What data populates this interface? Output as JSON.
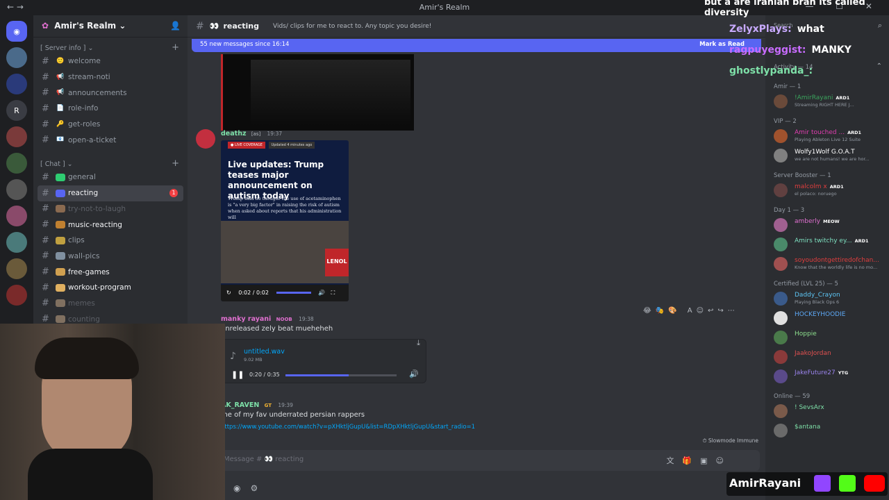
{
  "window": {
    "title": "Amir's Realm",
    "top_overlay_text": "but a are iranian bran its called diversity"
  },
  "server": {
    "name": "Amir's Realm",
    "rail_letter": "R"
  },
  "categories": {
    "server_info": "[ Server info ]",
    "chat": "[ Chat ]"
  },
  "channels_server_info": [
    {
      "name": "welcome",
      "emoji": "🙂"
    },
    {
      "name": "stream-noti",
      "emoji": "📢"
    },
    {
      "name": "announcements",
      "emoji": "📢"
    },
    {
      "name": "role-info",
      "emoji": "📄"
    },
    {
      "name": "get-roles",
      "emoji": "🔑"
    },
    {
      "name": "open-a-ticket",
      "emoji": "📧"
    }
  ],
  "channels_chat": [
    {
      "name": "general"
    },
    {
      "name": "reacting",
      "badge": "1"
    },
    {
      "name": "try-not-to-laugh"
    },
    {
      "name": "music-reacting"
    },
    {
      "name": "clips"
    },
    {
      "name": "wall-pics"
    },
    {
      "name": "free-games"
    },
    {
      "name": "workout-program"
    },
    {
      "name": "memes"
    },
    {
      "name": "counting"
    }
  ],
  "header": {
    "channel": "reacting",
    "topic": "Vids/ clips for me to react to. Any topic you desire!"
  },
  "new_messages_bar": {
    "text": "55 new messages since 16:14",
    "mark_read": "Mark as Read"
  },
  "messages": [
    {
      "author": "deathz",
      "tag": "[as]",
      "time": "19:37",
      "embed": {
        "live_label": "● LIVE COVERAGE",
        "updated_label": "Updated 4 minutes ago",
        "headline": "Live updates: Trump teases major announcement on autism today",
        "body": "Trump said he thought the use of acetaminophen is \"a very big factor\" in raising the risk of autism when asked about reports that his administration will",
        "video_time": "0:02 / 0:02",
        "video_side_text": "LENOL"
      }
    },
    {
      "author": "manky rayani",
      "tag": "NOOB",
      "time": "19:38",
      "text": "unreleased zely beat mueheheh",
      "attachment": {
        "filename": "untitled.wav",
        "size": "9.02 MB",
        "time": "0:20 / 0:35",
        "progress": 0.57
      }
    },
    {
      "author": "AK_RAVEN",
      "tag": "GT",
      "time": "19:39",
      "text": "me of my fav underrated persian rappers",
      "link": "https://www.youtube.com/watch?v=pXHktljGupU&list=RDpXHktljGupU&start_radio=1"
    }
  ],
  "slowmode": "Slowmode Immune",
  "input": {
    "placeholder": "Message #",
    "channel": "reacting"
  },
  "chat_overlay": [
    {
      "user": "ZelyxPlays:",
      "msg": "what",
      "color": "#c8aaff"
    },
    {
      "user": "ragpuyeggist:",
      "msg": "MANKY",
      "color": "#c86cff"
    },
    {
      "user": "ghostlypanda_:",
      "msg": "",
      "color": "#7ee0a8"
    }
  ],
  "member_search": "Search",
  "member_list": {
    "activity_label": "Activity — 14",
    "groups": [
      {
        "role": "Amir — 1",
        "members": [
          {
            "name": "!AmirRayani",
            "badge": "ARD1",
            "status": "Streaming RIGHT HERE J...",
            "color": "#3ba55d"
          }
        ]
      },
      {
        "role": "VIP — 2",
        "members": [
          {
            "name": "Amir touched ...",
            "badge": "ARD1",
            "status": "Playing Ableton Live 12 Suite",
            "color": "#e03eb0"
          },
          {
            "name": "Wolfy1Wolf G.O.A.T",
            "badge": "",
            "status": "we are not humans! we are hor...",
            "color": "#ffffff"
          }
        ]
      },
      {
        "role": "Server Booster — 1",
        "members": [
          {
            "name": "malcolm x",
            "badge": "ARD1",
            "status": "el polaco: noruego",
            "color": "#e03e3e"
          }
        ]
      },
      {
        "role": "Day 1 — 3",
        "members": [
          {
            "name": "amberly",
            "badge": "MEOW",
            "status": "",
            "color": "#e070d0"
          },
          {
            "name": "Amirs twitchy ey...",
            "badge": "ARD1",
            "status": "",
            "color": "#7ee0c0"
          },
          {
            "name": "soyoudontgettiredofchan...",
            "badge": "",
            "status": "Know that the worldly life is no mo...",
            "color": "#e03e3e"
          }
        ]
      },
      {
        "role": "Certified (LVL 25) — 5",
        "members": [
          {
            "name": "Daddy_Crayon",
            "badge": "",
            "status": "Playing Black Ops 6",
            "color": "#5dc6f5"
          },
          {
            "name": "HOCKEYHOODIE",
            "badge": "",
            "status": "",
            "color": "#5da8f5"
          },
          {
            "name": "Hoppie",
            "badge": "",
            "status": "",
            "color": "#8ee08e"
          },
          {
            "name": "JaakoJordan",
            "badge": "",
            "status": "",
            "color": "#e05050"
          },
          {
            "name": "JakeFuture27",
            "badge": "YTG",
            "status": "",
            "color": "#9b84ee"
          }
        ]
      },
      {
        "role": "Online — 59",
        "members": [
          {
            "name": "! SevsArx",
            "badge": "",
            "status": "",
            "color": "#7ee0a8"
          },
          {
            "name": "$antana",
            "badge": "",
            "status": "",
            "color": "#7ee0a8"
          }
        ]
      }
    ]
  },
  "amir_group_label": "Amir — 1",
  "brand_banner": "AmirRayani",
  "colors": {
    "accent": "#5865f2",
    "danger": "#f23f42",
    "online": "#23a55a"
  }
}
